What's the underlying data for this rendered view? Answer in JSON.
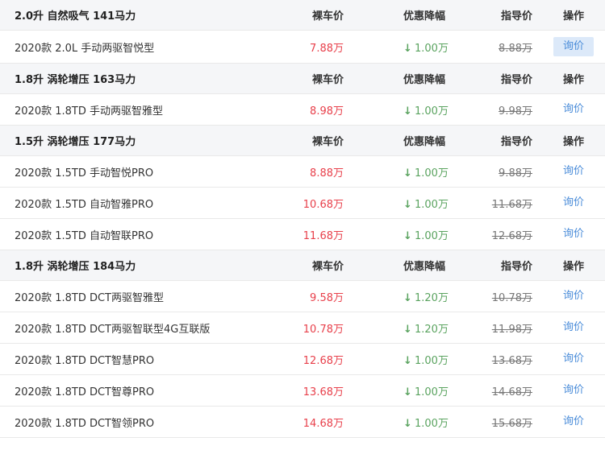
{
  "header_labels": {
    "price": "裸车价",
    "discount": "优惠降幅",
    "guide": "指导价",
    "operation": "操作"
  },
  "arrow": "↓",
  "groups": [
    {
      "title": "2.0升 自然吸气 141马力",
      "models": [
        {
          "name": "2020款 2.0L 手动两驱智悦型",
          "price": "7.88万",
          "discount": "1.00万",
          "guide": "8.88万",
          "action": "询价"
        }
      ]
    },
    {
      "title": "1.8升 涡轮增压 163马力",
      "models": [
        {
          "name": "2020款 1.8TD 手动两驱智雅型",
          "price": "8.98万",
          "discount": "1.00万",
          "guide": "9.98万",
          "action": "询价"
        }
      ]
    },
    {
      "title": "1.5升 涡轮增压 177马力",
      "models": [
        {
          "name": "2020款 1.5TD 手动智悦PRO",
          "price": "8.88万",
          "discount": "1.00万",
          "guide": "9.88万",
          "action": "询价"
        },
        {
          "name": "2020款 1.5TD 自动智雅PRO",
          "price": "10.68万",
          "discount": "1.00万",
          "guide": "11.68万",
          "action": "询价"
        },
        {
          "name": "2020款 1.5TD 自动智联PRO",
          "price": "11.68万",
          "discount": "1.00万",
          "guide": "12.68万",
          "action": "询价"
        }
      ]
    },
    {
      "title": "1.8升 涡轮增压 184马力",
      "models": [
        {
          "name": "2020款 1.8TD DCT两驱智雅型",
          "price": "9.58万",
          "discount": "1.20万",
          "guide": "10.78万",
          "action": "询价"
        },
        {
          "name": "2020款 1.8TD DCT两驱智联型4G互联版",
          "price": "10.78万",
          "discount": "1.20万",
          "guide": "11.98万",
          "action": "询价"
        },
        {
          "name": "2020款 1.8TD DCT智慧PRO",
          "price": "12.68万",
          "discount": "1.00万",
          "guide": "13.68万",
          "action": "询价"
        },
        {
          "name": "2020款 1.8TD DCT智尊PRO",
          "price": "13.68万",
          "discount": "1.00万",
          "guide": "14.68万",
          "action": "询价"
        },
        {
          "name": "2020款 1.8TD DCT智领PRO",
          "price": "14.68万",
          "discount": "1.00万",
          "guide": "15.68万",
          "action": "询价"
        }
      ]
    }
  ],
  "colors": {
    "price": "#e8404b",
    "discount": "#5aa35f",
    "link": "#4a8cd9",
    "header_bg": "#f5f6f8",
    "active_button_bg": "#dce9f9"
  }
}
